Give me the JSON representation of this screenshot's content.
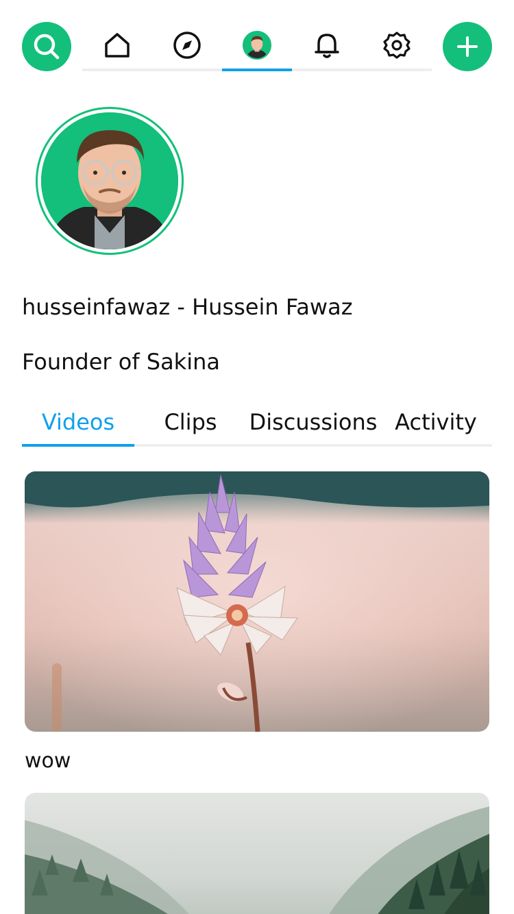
{
  "nav": {
    "search_icon": "search-icon",
    "add_icon": "plus-icon",
    "items": [
      {
        "icon": "home-icon",
        "active": false
      },
      {
        "icon": "compass-icon",
        "active": false
      },
      {
        "icon": "avatar",
        "active": true
      },
      {
        "icon": "bell-icon",
        "active": false
      },
      {
        "icon": "gear-icon",
        "active": false
      }
    ]
  },
  "profile": {
    "display_name": "husseinfawaz - Hussein Fawaz",
    "bio": "Founder of Sakina"
  },
  "tabs": [
    {
      "label": "Videos",
      "active": true
    },
    {
      "label": "Clips",
      "active": false
    },
    {
      "label": "Discussions",
      "active": false
    },
    {
      "label": "Activity",
      "active": false
    }
  ],
  "videos": [
    {
      "title": "wow"
    }
  ],
  "colors": {
    "accent_green": "#13bf7a",
    "accent_blue": "#10a0ea"
  }
}
